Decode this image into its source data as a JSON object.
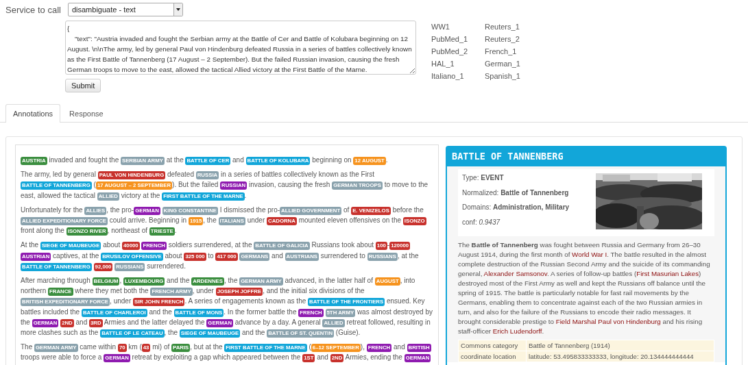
{
  "form": {
    "service_label": "Service to call",
    "service": "disambiguate - text",
    "query": "{\n    \"text\": \"Austria invaded and fought the Serbian army at the Battle of Cer and Battle of Kolubara beginning on 12 August. \\n\\nThe army, led by general Paul von Hindenburg defeated Russia in a series of battles collectively known as the First Battle of Tannenberg (17 August – 2 September). But the failed Russian invasion, causing the fresh German troops to move to the east, allowed the tactical Allied victory at the First Battle of the Marne.",
    "submit": "Submit"
  },
  "examples": [
    "WW1",
    "Reuters_1",
    "PubMed_1",
    "Reuters_2",
    "PubMed_2",
    "French_1",
    "HAL_1",
    "German_1",
    "Italiano_1",
    "Spanish_1"
  ],
  "tabs": [
    {
      "label": "Annotations",
      "selected": true
    },
    {
      "label": "Response",
      "selected": false
    }
  ],
  "annotations": [
    [
      {
        "entity": "AUSTRIA",
        "kind": "location"
      },
      {
        "text": " invaded and fought the "
      },
      {
        "entity": "SERBIAN ARMY",
        "kind": "group"
      },
      {
        "text": " at the "
      },
      {
        "entity": "BATTLE OF CER",
        "kind": "event"
      },
      {
        "text": " and "
      },
      {
        "entity": "BATTLE OF KOLUBARA",
        "kind": "event"
      },
      {
        "text": " beginning on "
      },
      {
        "entity": "12 AUGUST",
        "kind": "date"
      },
      {
        "text": "."
      }
    ],
    [
      {
        "text": "The army, led by general "
      },
      {
        "entity": "PAUL VON HINDENBURG",
        "kind": "person"
      },
      {
        "text": " defeated "
      },
      {
        "entity": "RUSSIA",
        "kind": "group"
      },
      {
        "text": " in a series of battles collectively known as the First "
      },
      {
        "entity": "BATTLE OF TANNENBERG",
        "kind": "event"
      },
      {
        "text": " ("
      },
      {
        "entity": "17 AUGUST – 2 SEPTEMBER",
        "kind": "date"
      },
      {
        "text": "). But the failed "
      },
      {
        "entity": "RUSSIAN",
        "kind": "nationality"
      },
      {
        "text": " invasion, causing the fresh "
      },
      {
        "entity": "GERMAN TROOPS",
        "kind": "group"
      },
      {
        "text": " to move to the east, allowed the tactical "
      },
      {
        "entity": "ALLIED",
        "kind": "group"
      },
      {
        "text": " victory at the "
      },
      {
        "entity": "FIRST BATTLE OF THE MARNE",
        "kind": "event"
      },
      {
        "text": "."
      }
    ],
    [
      {
        "text": "Unfortunately for the "
      },
      {
        "entity": "ALLIES",
        "kind": "group"
      },
      {
        "text": ", the pro-"
      },
      {
        "entity": "GERMAN",
        "kind": "nationality"
      },
      {
        "entity": "KING CONSTANTINE",
        "kind": "group"
      },
      {
        "text": " I dismissed the pro-"
      },
      {
        "entity": "ALLIED GOVERNMENT",
        "kind": "group"
      },
      {
        "text": " of "
      },
      {
        "entity": "E. VENIZELOS",
        "kind": "person"
      },
      {
        "text": " before the "
      },
      {
        "entity": "ALLIED EXPEDITIONARY FORCE",
        "kind": "group"
      },
      {
        "text": " could arrive. Beginning in "
      },
      {
        "entity": "1915",
        "kind": "date"
      },
      {
        "text": ", the "
      },
      {
        "entity": "ITALIANS",
        "kind": "group"
      },
      {
        "text": " under "
      },
      {
        "entity": "CADORNA",
        "kind": "person"
      },
      {
        "text": " mounted eleven offensives on the "
      },
      {
        "entity": "ISONZO",
        "kind": "person"
      },
      {
        "text": " front along the "
      },
      {
        "entity": "ISONZO RIVER",
        "kind": "location"
      },
      {
        "text": ", northeast of "
      },
      {
        "entity": "TRIESTE",
        "kind": "location"
      },
      {
        "text": "."
      }
    ],
    [
      {
        "text": "At the "
      },
      {
        "entity": "SIEGE OF MAUBEUGE",
        "kind": "event"
      },
      {
        "text": " about "
      },
      {
        "entity": "40000",
        "kind": "person"
      },
      {
        "entity": "FRENCH",
        "kind": "nationality"
      },
      {
        "text": " soldiers surrendered, at the "
      },
      {
        "entity": "BATTLE OF GALICIA",
        "kind": "group"
      },
      {
        "text": " Russians took about "
      },
      {
        "entity": "100",
        "kind": "person"
      },
      {
        "text": "-"
      },
      {
        "entity": "120000",
        "kind": "person"
      },
      {
        "entity": "AUSTRIAN",
        "kind": "nationality"
      },
      {
        "text": " captives, at the "
      },
      {
        "entity": "BRUSILOV OFFENSIVE",
        "kind": "event"
      },
      {
        "text": " about "
      },
      {
        "entity": "325 000",
        "kind": "person"
      },
      {
        "text": " to "
      },
      {
        "entity": "417 000",
        "kind": "person"
      },
      {
        "entity": "GERMANS",
        "kind": "group"
      },
      {
        "text": " and "
      },
      {
        "entity": "AUSTRIANS",
        "kind": "group"
      },
      {
        "text": " surrendered to "
      },
      {
        "entity": "RUSSIANS",
        "kind": "group"
      },
      {
        "text": ", at the "
      },
      {
        "entity": "BATTLE OF TANNENBERG",
        "kind": "event"
      },
      {
        "entity": "92,000",
        "kind": "person"
      },
      {
        "entity": "RUSSIANS",
        "kind": "group"
      },
      {
        "text": " surrendered."
      }
    ],
    [
      {
        "text": "After marching through "
      },
      {
        "entity": "BELGIUM",
        "kind": "location"
      },
      {
        "text": ", "
      },
      {
        "entity": "LUXEMBOURG",
        "kind": "location"
      },
      {
        "text": " and the "
      },
      {
        "entity": "ARDENNES",
        "kind": "location"
      },
      {
        "text": ", the "
      },
      {
        "entity": "GERMAN ARMY",
        "kind": "group"
      },
      {
        "text": " advanced, in the latter half of "
      },
      {
        "entity": "AUGUST",
        "kind": "date"
      },
      {
        "text": ", into northern "
      },
      {
        "entity": "FRANCE",
        "kind": "location"
      },
      {
        "text": " where they met both the "
      },
      {
        "entity": "FRENCH ARMY",
        "kind": "group"
      },
      {
        "text": ", under "
      },
      {
        "entity": "JOSEPH JOFFRE",
        "kind": "person"
      },
      {
        "text": ", and the initial six divisions of the "
      },
      {
        "entity": "BRITISH EXPEDITIONARY FORCE",
        "kind": "group"
      },
      {
        "text": ", under "
      },
      {
        "entity": "SIR JOHN FRENCH",
        "kind": "person"
      },
      {
        "text": ". A series of engagements known as the "
      },
      {
        "entity": "BATTLE OF THE FRONTIERS",
        "kind": "event"
      },
      {
        "text": " ensued. Key battles included the "
      },
      {
        "entity": "BATTLE OF CHARLEROI",
        "kind": "event"
      },
      {
        "text": " and the "
      },
      {
        "entity": "BATTLE OF MONS",
        "kind": "event"
      },
      {
        "text": ". In the former battle the "
      },
      {
        "entity": "FRENCH",
        "kind": "nationality"
      },
      {
        "entity": "5TH ARMY",
        "kind": "group"
      },
      {
        "text": " was almost destroyed by the "
      },
      {
        "entity": "GERMAN",
        "kind": "nationality"
      },
      {
        "entity": "2ND",
        "kind": "person"
      },
      {
        "text": " and "
      },
      {
        "entity": "3RD",
        "kind": "person"
      },
      {
        "text": " Armies and the latter delayed the "
      },
      {
        "entity": "GERMAN",
        "kind": "nationality"
      },
      {
        "text": " advance by a day. A general "
      },
      {
        "entity": "ALLIED",
        "kind": "group"
      },
      {
        "text": " retreat followed, resulting in more clashes such as the "
      },
      {
        "entity": "BATTLE OF LE CATEAU",
        "kind": "event"
      },
      {
        "text": ", the "
      },
      {
        "entity": "SIEGE OF MAUBEUGE",
        "kind": "event"
      },
      {
        "text": " and the "
      },
      {
        "entity": "BATTLE OF ST. QUENTIN",
        "kind": "group"
      },
      {
        "text": " (Guise)."
      }
    ],
    [
      {
        "text": "The "
      },
      {
        "entity": "GERMAN ARMY",
        "kind": "group"
      },
      {
        "text": " came within "
      },
      {
        "entity": "70",
        "kind": "person"
      },
      {
        "text": " km ("
      },
      {
        "entity": "43",
        "kind": "person"
      },
      {
        "text": " mi) of "
      },
      {
        "entity": "PARIS",
        "kind": "location"
      },
      {
        "text": ", but at the "
      },
      {
        "entity": "FIRST BATTLE OF THE MARNE",
        "kind": "event"
      },
      {
        "text": " ("
      },
      {
        "entity": "6–12 SEPTEMBER",
        "kind": "date"
      },
      {
        "text": "), "
      },
      {
        "entity": "FRENCH",
        "kind": "nationality"
      },
      {
        "text": " and "
      },
      {
        "entity": "BRITISH",
        "kind": "nationality"
      },
      {
        "text": " troops were able to force a "
      },
      {
        "entity": "GERMAN",
        "kind": "nationality"
      },
      {
        "text": " retreat by exploiting a gap which appeared between the "
      },
      {
        "entity": "1ST",
        "kind": "person"
      },
      {
        "text": " and "
      },
      {
        "entity": "2ND",
        "kind": "person"
      },
      {
        "text": " Armies, ending the "
      },
      {
        "entity": "GERMAN",
        "kind": "nationality"
      }
    ]
  ],
  "infobox": {
    "title": "BATTLE OF TANNENBERG",
    "fields": [
      {
        "label": "Type: ",
        "value": "EVENT",
        "kind": "bold"
      },
      {
        "label": "Normalized: ",
        "value": "Battle of Tannenberg",
        "kind": "bold"
      },
      {
        "label": "Domains: ",
        "value": "Administration, Military",
        "kind": "bold"
      },
      {
        "label": "conf: ",
        "value": "0.9437",
        "kind": "italic"
      }
    ],
    "description": [
      {
        "kind": "text",
        "text": "The "
      },
      {
        "kind": "bold",
        "text": "Battle of Tannenberg"
      },
      {
        "kind": "text",
        "text": " was fought between Russia and Germany from 26–30 August 1914, during the first month of "
      },
      {
        "kind": "link",
        "text": "World War I"
      },
      {
        "kind": "text",
        "text": ". The battle resulted in the almost complete destruction of the Russian Second Army and the suicide of its commanding general, "
      },
      {
        "kind": "link",
        "text": "Alexander Samsonov"
      },
      {
        "kind": "text",
        "text": ". A series of follow-up battles ("
      },
      {
        "kind": "link",
        "text": "First Masurian Lakes"
      },
      {
        "kind": "text",
        "text": ") destroyed most of the First Army as well and kept the Russians off balance until the spring of 1915. The battle is particularly notable for fast rail movements by the Germans, enabling them to concentrate against each of the two Russian armies in turn, and also for the failure of the Russians to encode their radio messages. It brought considerable prestige to "
      },
      {
        "kind": "link",
        "text": "Field Marshal Paul von Hindenburg"
      },
      {
        "kind": "text",
        "text": " and his rising staff-officer "
      },
      {
        "kind": "link",
        "text": "Erich Ludendorff"
      },
      {
        "kind": "text",
        "text": "."
      }
    ],
    "properties": [
      {
        "name": "Commons category",
        "value": "Battle of Tannenberg (1914)"
      },
      {
        "name": "coordinate location",
        "value": "latitude: 53.495833333333, longitude: 20.134444444444"
      }
    ]
  }
}
